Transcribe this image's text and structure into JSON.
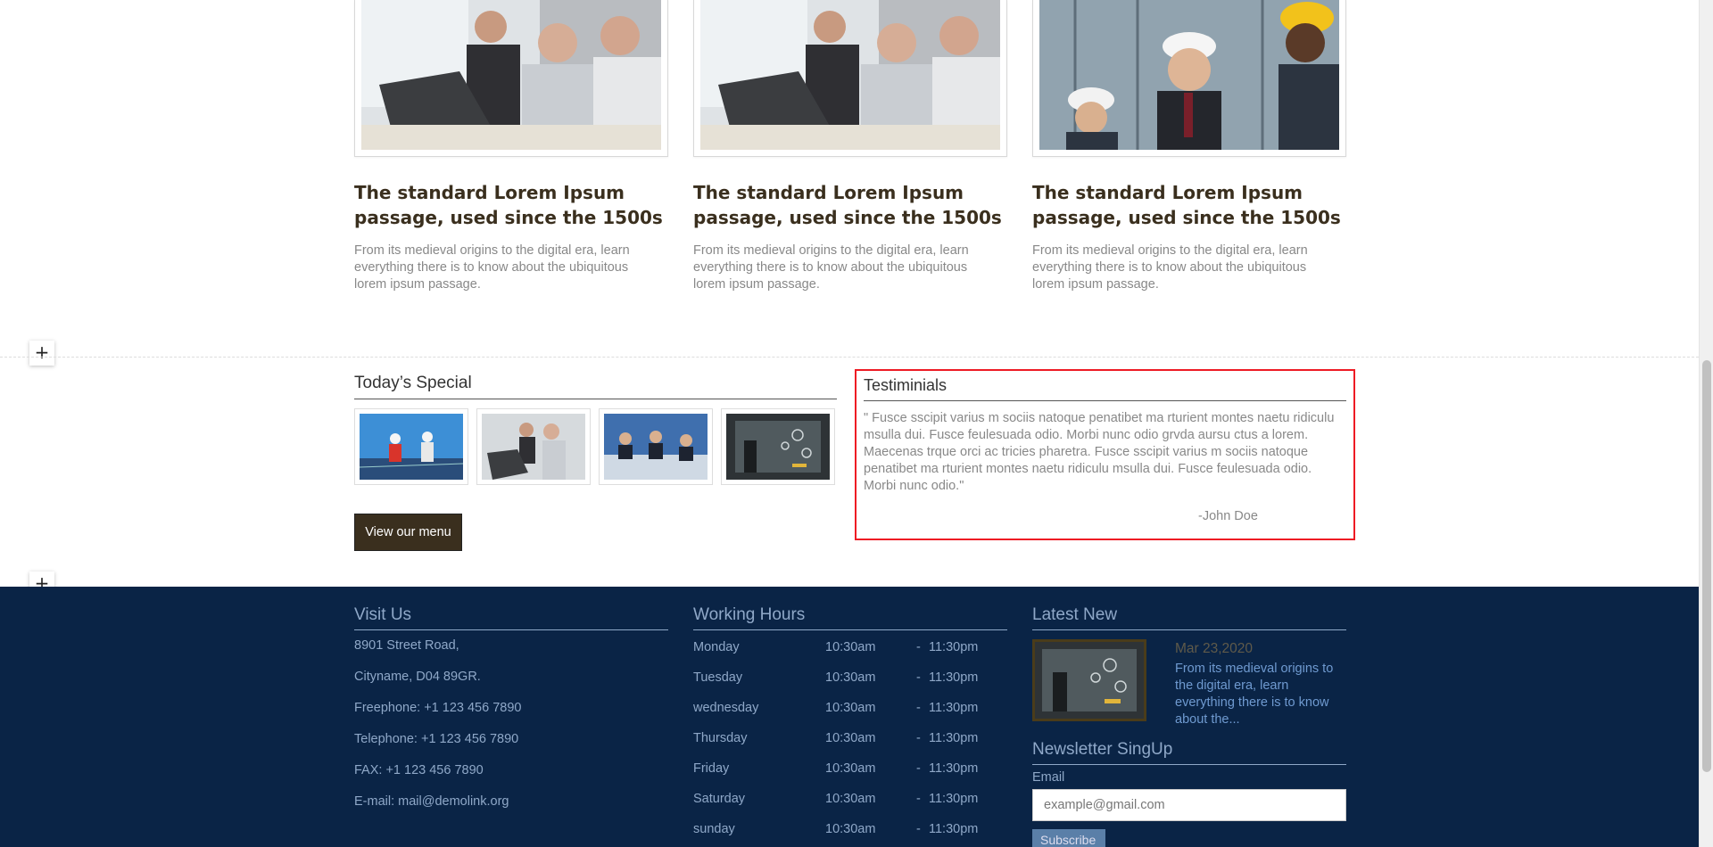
{
  "cards": [
    {
      "title": "The standard Lorem Ipsum passage, used since the 1500s",
      "text": "From its medieval origins to the digital era, learn everything there is to know about the ubiquitous lorem ipsum passage."
    },
    {
      "title": "The standard Lorem Ipsum passage, used since the 1500s",
      "text": "From its medieval origins to the digital era, learn everything there is to know about the ubiquitous lorem ipsum passage."
    },
    {
      "title": "The standard Lorem Ipsum passage, used since the 1500s",
      "text": "From its medieval origins to the digital era, learn everything there is to know about the ubiquitous lorem ipsum passage."
    }
  ],
  "add_section_label": "+",
  "special": {
    "title": "Today’s Special",
    "button_label": "View our menu"
  },
  "testimonials": {
    "title": "Testiminials",
    "quote": "\" Fusce sscipit varius m sociis natoque penatibet ma rturient montes naetu ridiculu msulla dui. Fusce feulesuada odio. Morbi nunc odio grvda aursu ctus a lorem. Maecenas trque orci ac tricies pharetra. Fusce sscipit varius m sociis natoque penatibet ma rturient montes naetu ridiculu msulla dui. Fusce feulesuada odio. Morbi nunc odio.\"",
    "author": "-John Doe"
  },
  "footer": {
    "visit": {
      "title": "Visit Us",
      "lines": [
        "8901 Street Road,",
        "Cityname, D04 89GR.",
        "Freephone: +1 123 456 7890",
        "Telephone: +1 123 456 7890",
        "FAX: +1 123 456 7890",
        "E-mail: mail@demolink.org"
      ]
    },
    "hours": {
      "title": "Working Hours",
      "rows": [
        {
          "day": "Monday",
          "open": "10:30am",
          "dash": "-",
          "close": "11:30pm"
        },
        {
          "day": "Tuesday",
          "open": "10:30am",
          "dash": "-",
          "close": "11:30pm"
        },
        {
          "day": "wednesday",
          "open": "10:30am",
          "dash": "-",
          "close": "11:30pm"
        },
        {
          "day": "Thursday",
          "open": "10:30am",
          "dash": "-",
          "close": "11:30pm"
        },
        {
          "day": "Friday",
          "open": "10:30am",
          "dash": "-",
          "close": "11:30pm"
        },
        {
          "day": "Saturday",
          "open": "10:30am",
          "dash": "-",
          "close": "11:30pm"
        },
        {
          "day": "sunday",
          "open": "10:30am",
          "dash": "-",
          "close": "11:30pm"
        }
      ]
    },
    "news": {
      "title": "Latest New",
      "date": "Mar 23,2020",
      "text": "From its medieval origins to the digital era, learn everything there is to know about the..."
    },
    "newsletter": {
      "title": "Newsletter SingUp",
      "email_label": "Email",
      "email_placeholder": "example@gmail.com",
      "email_value": "",
      "subscribe_label": "Subscribe"
    }
  }
}
